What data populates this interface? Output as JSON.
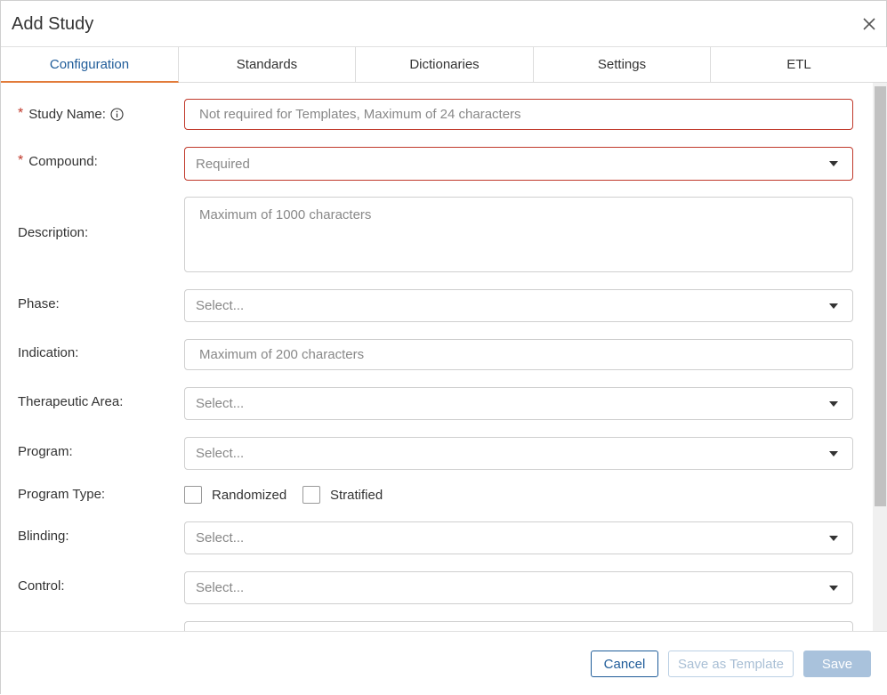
{
  "dialog": {
    "title": "Add Study"
  },
  "tabs": [
    {
      "label": "Configuration",
      "active": true
    },
    {
      "label": "Standards",
      "active": false
    },
    {
      "label": "Dictionaries",
      "active": false
    },
    {
      "label": "Settings",
      "active": false
    },
    {
      "label": "ETL",
      "active": false
    }
  ],
  "form": {
    "study_name": {
      "label": "Study Name:",
      "required": true,
      "placeholder": "Not required for Templates, Maximum of 24 characters"
    },
    "compound": {
      "label": "Compound:",
      "required": true,
      "placeholder": "Required"
    },
    "description": {
      "label": "Description:",
      "placeholder": "Maximum of 1000 characters"
    },
    "phase": {
      "label": "Phase:",
      "placeholder": "Select..."
    },
    "indication": {
      "label": "Indication:",
      "placeholder": "Maximum of 200 characters"
    },
    "therapeutic_area": {
      "label": "Therapeutic Area:",
      "placeholder": "Select..."
    },
    "program": {
      "label": "Program:",
      "placeholder": "Select..."
    },
    "program_type": {
      "label": "Program Type:",
      "options": [
        {
          "label": "Randomized",
          "checked": false
        },
        {
          "label": "Stratified",
          "checked": false
        }
      ]
    },
    "blinding": {
      "label": "Blinding:",
      "placeholder": "Select..."
    },
    "control": {
      "label": "Control:",
      "placeholder": "Select..."
    }
  },
  "footer": {
    "cancel_label": "Cancel",
    "save_template_label": "Save as Template",
    "save_label": "Save"
  },
  "colors": {
    "accent": "#1f5c99",
    "active_tab_underline": "#e27b3a",
    "error_border": "#c0392b",
    "disabled_button": "#a9c2dc"
  },
  "icons": {
    "close": "close-icon",
    "info": "info-icon",
    "caret": "chevron-down-icon"
  }
}
